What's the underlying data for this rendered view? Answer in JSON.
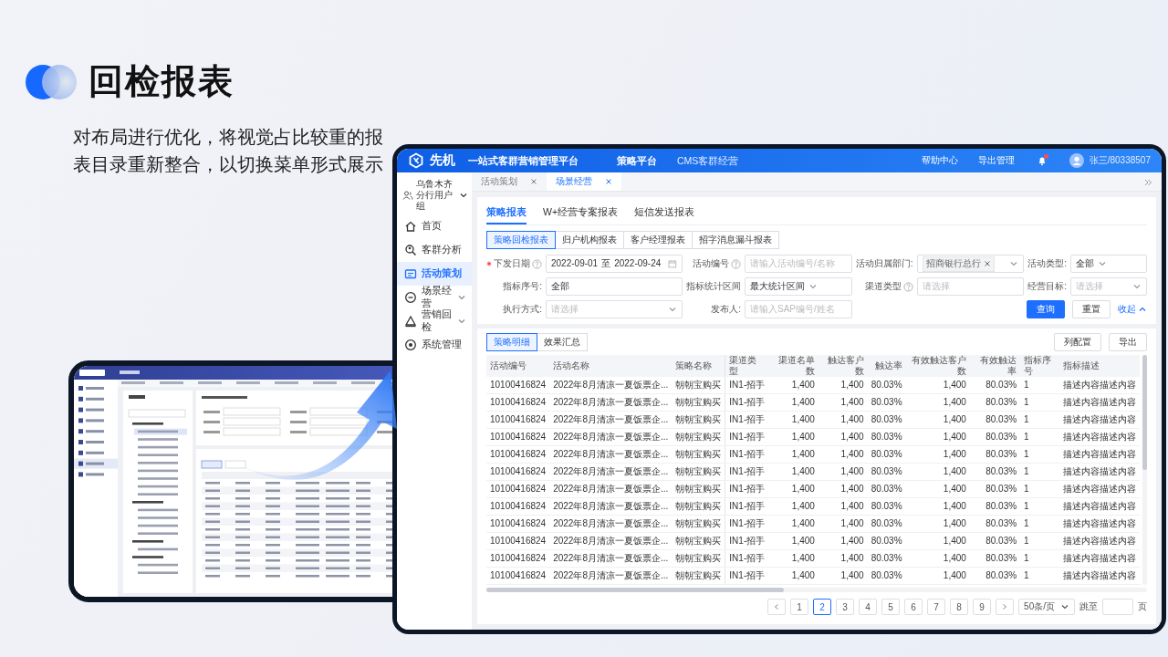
{
  "slide": {
    "title": "回检报表",
    "description": "对布局进行优化，将视觉占比较重的报表目录重新整合，以切换菜单形式展示"
  },
  "app": {
    "header": {
      "logo": "先机",
      "product": "一站式客群营销管理平台",
      "nav": [
        {
          "label": "策略平台",
          "selected": true
        },
        {
          "label": "CMS客群经营",
          "selected": false
        }
      ],
      "links": [
        "帮助中心",
        "导出管理"
      ],
      "notification": true,
      "user": "张三/80338507"
    },
    "sidebar": {
      "org": "乌鲁木齐分行用户组",
      "items": [
        {
          "label": "首页",
          "kind": "home",
          "selected": false,
          "expandable": false
        },
        {
          "label": "客群分析",
          "kind": "analysis",
          "selected": false,
          "expandable": false
        },
        {
          "label": "活动策划",
          "kind": "plan",
          "selected": true,
          "expandable": false
        },
        {
          "label": "场景经营",
          "kind": "scene",
          "selected": false,
          "expandable": true
        },
        {
          "label": "营销回检",
          "kind": "review",
          "selected": false,
          "expandable": true
        },
        {
          "label": "系统管理",
          "kind": "system",
          "selected": false,
          "expandable": false
        }
      ]
    },
    "page_tabs": [
      {
        "label": "活动策划",
        "selected": false
      },
      {
        "label": "场景经营",
        "selected": true
      }
    ],
    "report_tabs": [
      {
        "label": "策略报表",
        "selected": true
      },
      {
        "label": "W+经营专案报表",
        "selected": false
      },
      {
        "label": "短信发送报表",
        "selected": false
      }
    ],
    "report_types": [
      {
        "label": "策略回检报表",
        "selected": true
      },
      {
        "label": "归户机构报表",
        "selected": false
      },
      {
        "label": "客户经理报表",
        "selected": false
      },
      {
        "label": "招字消息漏斗报表",
        "selected": false
      }
    ],
    "filters": [
      {
        "label": "下发日期",
        "required": true,
        "help": true,
        "kind": "daterange",
        "start": "2022-09-01",
        "separator": "至",
        "end": "2022-09-24"
      },
      {
        "label": "活动编号",
        "required": false,
        "help": true,
        "kind": "input",
        "placeholder": "请输入活动编号/名称"
      },
      {
        "label": "活动归属部门:",
        "required": false,
        "help": false,
        "kind": "tags",
        "tags": [
          "招商银行总行"
        ]
      },
      {
        "label": "活动类型:",
        "required": false,
        "help": false,
        "kind": "select",
        "value": "全部"
      },
      {
        "label": "指标序号:",
        "required": false,
        "help": false,
        "kind": "input",
        "value": "全部"
      },
      {
        "label": "指标统计区间",
        "required": false,
        "help": false,
        "kind": "select",
        "value": "最大统计区间"
      },
      {
        "label": "渠道类型",
        "required": false,
        "help": true,
        "kind": "input",
        "placeholder": "请选择"
      },
      {
        "label": "经营目标:",
        "required": false,
        "help": false,
        "kind": "select",
        "placeholder": "请选择"
      },
      {
        "label": "执行方式:",
        "required": false,
        "help": false,
        "kind": "select",
        "placeholder": "请选择"
      },
      {
        "label": "发布人:",
        "required": false,
        "help": false,
        "kind": "input",
        "placeholder": "请输入SAP编号/姓名"
      }
    ],
    "filter_actions": [
      {
        "label": "查询",
        "kind": "primary"
      },
      {
        "label": "重置",
        "kind": "default"
      },
      {
        "label": "收起",
        "kind": "link"
      }
    ],
    "result_tabs": [
      {
        "label": "策略明细",
        "selected": true
      },
      {
        "label": "效果汇总",
        "selected": false
      }
    ],
    "table_actions": [
      "列配置",
      "导出"
    ],
    "table": {
      "columns": [
        "活动编号",
        "活动名称",
        "策略名称",
        "渠道类型",
        "渠道名单数",
        "触达客户数",
        "触达率",
        "有效触达客户数",
        "有效触达率",
        "指标序号",
        "指标描述"
      ],
      "rows": [
        [
          "10100416824",
          "2022年8月清凉一夏饭票企...",
          "朝朝宝购买",
          "IN1-招手",
          "1,400",
          "1,400",
          "80.03%",
          "1,400",
          "80.03%",
          "1",
          "描述内容描述内容"
        ],
        [
          "10100416824",
          "2022年8月清凉一夏饭票企...",
          "朝朝宝购买",
          "IN1-招手",
          "1,400",
          "1,400",
          "80.03%",
          "1,400",
          "80.03%",
          "1",
          "描述内容描述内容"
        ],
        [
          "10100416824",
          "2022年8月清凉一夏饭票企...",
          "朝朝宝购买",
          "IN1-招手",
          "1,400",
          "1,400",
          "80.03%",
          "1,400",
          "80.03%",
          "1",
          "描述内容描述内容"
        ],
        [
          "10100416824",
          "2022年8月清凉一夏饭票企...",
          "朝朝宝购买",
          "IN1-招手",
          "1,400",
          "1,400",
          "80.03%",
          "1,400",
          "80.03%",
          "1",
          "描述内容描述内容"
        ],
        [
          "10100416824",
          "2022年8月清凉一夏饭票企...",
          "朝朝宝购买",
          "IN1-招手",
          "1,400",
          "1,400",
          "80.03%",
          "1,400",
          "80.03%",
          "1",
          "描述内容描述内容"
        ],
        [
          "10100416824",
          "2022年8月清凉一夏饭票企...",
          "朝朝宝购买",
          "IN1-招手",
          "1,400",
          "1,400",
          "80.03%",
          "1,400",
          "80.03%",
          "1",
          "描述内容描述内容"
        ],
        [
          "10100416824",
          "2022年8月清凉一夏饭票企...",
          "朝朝宝购买",
          "IN1-招手",
          "1,400",
          "1,400",
          "80.03%",
          "1,400",
          "80.03%",
          "1",
          "描述内容描述内容"
        ],
        [
          "10100416824",
          "2022年8月清凉一夏饭票企...",
          "朝朝宝购买",
          "IN1-招手",
          "1,400",
          "1,400",
          "80.03%",
          "1,400",
          "80.03%",
          "1",
          "描述内容描述内容"
        ],
        [
          "10100416824",
          "2022年8月清凉一夏饭票企...",
          "朝朝宝购买",
          "IN1-招手",
          "1,400",
          "1,400",
          "80.03%",
          "1,400",
          "80.03%",
          "1",
          "描述内容描述内容"
        ],
        [
          "10100416824",
          "2022年8月清凉一夏饭票企...",
          "朝朝宝购买",
          "IN1-招手",
          "1,400",
          "1,400",
          "80.03%",
          "1,400",
          "80.03%",
          "1",
          "描述内容描述内容"
        ],
        [
          "10100416824",
          "2022年8月清凉一夏饭票企...",
          "朝朝宝购买",
          "IN1-招手",
          "1,400",
          "1,400",
          "80.03%",
          "1,400",
          "80.03%",
          "1",
          "描述内容描述内容"
        ],
        [
          "10100416824",
          "2022年8月清凉一夏饭票企...",
          "朝朝宝购买",
          "IN1-招手",
          "1,400",
          "1,400",
          "80.03%",
          "1,400",
          "80.03%",
          "1",
          "描述内容描述内容"
        ]
      ]
    },
    "pagination": {
      "pages": [
        {
          "label": "1",
          "selected": false
        },
        {
          "label": "2",
          "selected": true
        },
        {
          "label": "3",
          "selected": false
        },
        {
          "label": "4",
          "selected": false
        },
        {
          "label": "5",
          "selected": false
        },
        {
          "label": "6",
          "selected": false
        },
        {
          "label": "7",
          "selected": false
        },
        {
          "label": "8",
          "selected": false
        },
        {
          "label": "9",
          "selected": false
        }
      ],
      "page_size": "50条/页",
      "jump_label": "跳至",
      "jump_suffix": "页"
    }
  }
}
